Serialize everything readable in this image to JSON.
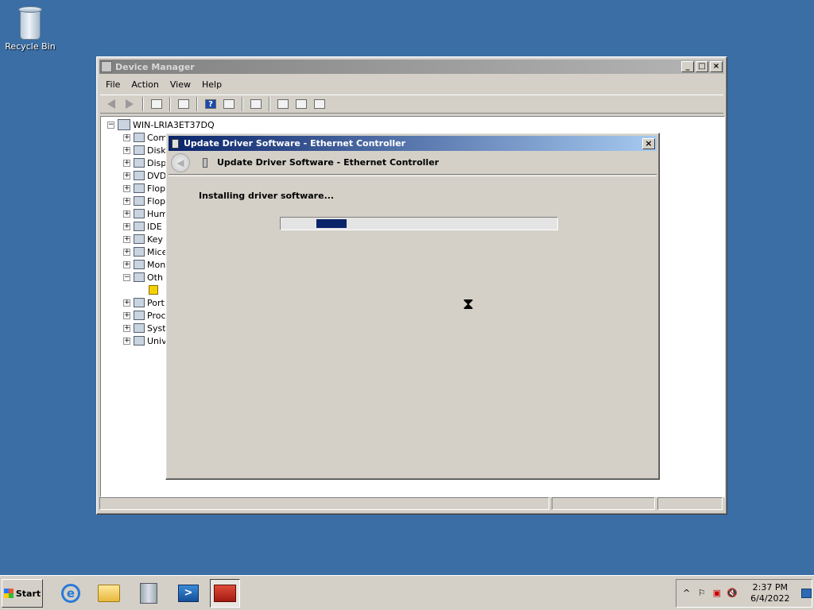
{
  "desktop": {
    "icons": [
      {
        "label": "Recycle Bin",
        "icon": "recycle-bin-icon"
      }
    ]
  },
  "device_manager": {
    "title": "Device Manager",
    "controls": {
      "minimize": "_",
      "maximize": "□",
      "close": "×"
    },
    "menu": [
      "File",
      "Action",
      "View",
      "Help"
    ],
    "toolbar_icons": [
      "back-icon",
      "forward-icon",
      "show-hide-console-tree-icon",
      "properties-icon",
      "help-icon",
      "show-hide-action-pane-icon",
      "scan-hardware-icon",
      "update-driver-icon",
      "uninstall-icon",
      "disable-icon"
    ],
    "tree": {
      "root": "WIN-LRIA3ET37DQ",
      "items": [
        {
          "label": "Com",
          "expander": "+"
        },
        {
          "label": "Disk",
          "expander": "+"
        },
        {
          "label": "Disp",
          "expander": "+"
        },
        {
          "label": "DVD",
          "expander": "+"
        },
        {
          "label": "Flop",
          "expander": "+"
        },
        {
          "label": "Flop",
          "expander": "+"
        },
        {
          "label": "Hum",
          "expander": "+"
        },
        {
          "label": "IDE",
          "expander": "+"
        },
        {
          "label": "Key",
          "expander": "+"
        },
        {
          "label": "Mice",
          "expander": "+"
        },
        {
          "label": "Mon",
          "expander": "+"
        },
        {
          "label": "Oth",
          "expander": "−"
        },
        {
          "label": "",
          "expander": ""
        },
        {
          "label": "Port",
          "expander": "+"
        },
        {
          "label": "Proc",
          "expander": "+"
        },
        {
          "label": "Syst",
          "expander": "+"
        },
        {
          "label": "Univ",
          "expander": "+"
        }
      ]
    }
  },
  "dialog": {
    "title": "Update Driver Software - Ethernet Controller",
    "close": "×",
    "heading": "Update Driver Software - Ethernet Controller",
    "status": "Installing driver software...",
    "progress": {
      "state": "indeterminate",
      "chunk_position": 0.13,
      "color": "#0a246a"
    },
    "cursor": "hourglass-icon"
  },
  "taskbar": {
    "start_label": "Start",
    "apps": [
      "internet-explorer-icon",
      "windows-explorer-icon",
      "server-manager-icon",
      "powershell-icon",
      "device-manager-toolbox-icon"
    ],
    "tray": {
      "chevron": "^",
      "icons": [
        "action-center-flag-icon",
        "network-error-icon",
        "volume-muted-icon"
      ],
      "time": "2:37 PM",
      "date": "6/4/2022"
    }
  },
  "colors": {
    "desktop": "#3a6ea5",
    "dialog_title_active": "#0a246a",
    "window_title_inactive": "#808080"
  }
}
